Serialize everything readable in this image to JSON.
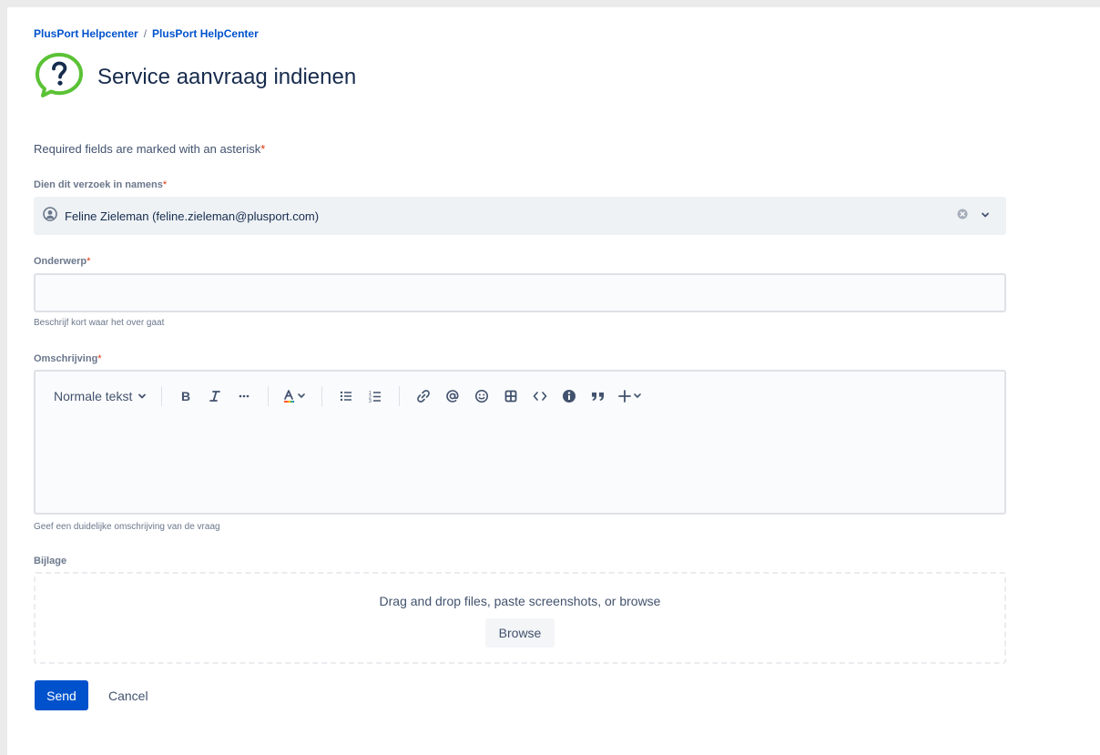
{
  "breadcrumb": {
    "items": [
      "PlusPort Helpcenter",
      "PlusPort HelpCenter"
    ],
    "separator": "/"
  },
  "page": {
    "title": "Service aanvraag indienen",
    "icon": "question-speech-bubble-icon",
    "accent_color": "#5bc236"
  },
  "form": {
    "required_note": "Required fields are marked with an asterisk",
    "asterisk": "*",
    "on_behalf": {
      "label": "Dien dit verzoek in namens",
      "value": "Feline Zieleman (feline.zieleman@plusport.com)"
    },
    "subject": {
      "label": "Onderwerp",
      "value": "",
      "placeholder": "",
      "helper": "Beschrijf kort waar het over gaat"
    },
    "description": {
      "label": "Omschrijving",
      "helper": "Geef een duidelijke omschrijving van de vraag",
      "toolbar": {
        "text_style": "Normale tekst",
        "icons": [
          "bold-icon",
          "italic-icon",
          "more-formatting-icon",
          "text-color-icon",
          "bullet-list-icon",
          "numbered-list-icon",
          "link-icon",
          "mention-icon",
          "emoji-icon",
          "table-icon",
          "code-icon",
          "info-panel-icon",
          "quote-icon",
          "insert-plus-icon"
        ]
      }
    },
    "attachment": {
      "label": "Bijlage",
      "dropzone_text": "Drag and drop files, paste screenshots, or browse",
      "browse_label": "Browse"
    }
  },
  "actions": {
    "send_label": "Send",
    "cancel_label": "Cancel",
    "primary_color": "#0052cc"
  }
}
